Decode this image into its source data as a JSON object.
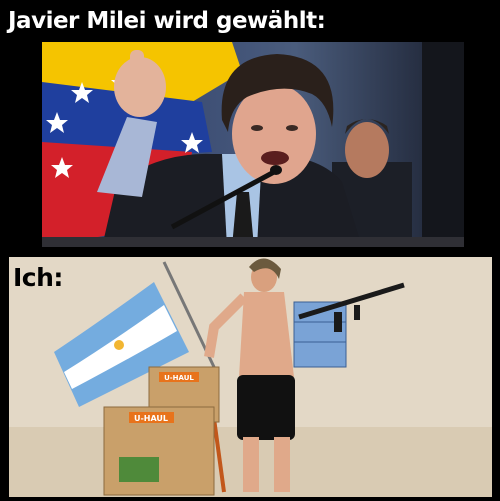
{
  "top_caption": "Javier Milei wird gewählt:",
  "bottom_caption": "Ich:",
  "box_label": "U-HAUL",
  "colors": {
    "background": "#000000",
    "caption_top": "#ffffff",
    "caption_bottom": "#000000",
    "sand": "#e3d8c6",
    "argentina_blue": "#74acdf",
    "venezuela_yellow": "#f5c400",
    "venezuela_blue": "#1f3f9e",
    "venezuela_red": "#d3202a",
    "cardboard": "#c9a06a",
    "uhaul_orange": "#e8731b"
  }
}
